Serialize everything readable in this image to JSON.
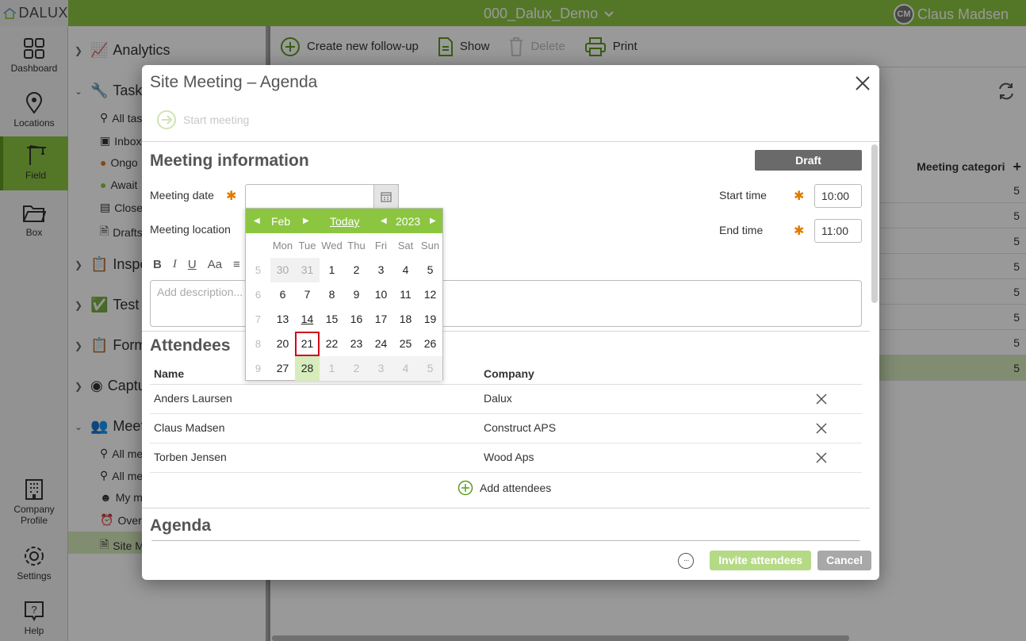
{
  "app": {
    "logo_text": "DALUX",
    "project": "000_Dalux_Demo",
    "user_initials": "CM",
    "user_name": "Claus Madsen"
  },
  "nav": {
    "dashboard": "Dashboard",
    "locations": "Locations",
    "field": "Field",
    "box": "Box",
    "company_profile_1": "Company",
    "company_profile_2": "Profile",
    "settings": "Settings",
    "help": "Help"
  },
  "tree": {
    "analytics": "Analytics",
    "tasks": "Tasks",
    "all_tasks": "All tas",
    "inbox": "Inbox",
    "ongoing": "Ongo",
    "awaiting": "Await",
    "closed": "Close",
    "drafts": "Drafts",
    "inspections": "Inspe",
    "test": "Test",
    "forms": "Form",
    "capture": "Captu",
    "meetings": "Meet",
    "all_meetings_1": "All me",
    "all_meetings_2": "All me",
    "my_meetings": "My m",
    "overdue": "Overd",
    "site_meeting": "Site M"
  },
  "toolbar": {
    "create": "Create new follow-up",
    "show": "Show",
    "delete": "Delete",
    "print": "Print"
  },
  "list": {
    "column": "Meeting categori",
    "values": [
      "5",
      "5",
      "5",
      "5",
      "5",
      "5",
      "5",
      "5"
    ]
  },
  "modal": {
    "title": "Site Meeting – Agenda",
    "start_meeting": "Start meeting",
    "meeting_info_title": "Meeting information",
    "status": "Draft",
    "meeting_date_label": "Meeting date",
    "meeting_date_value": "",
    "meeting_location_label": "Meeting location",
    "start_time_label": "Start time",
    "start_time_value": "10:00",
    "end_time_label": "End time",
    "end_time_value": "11:00",
    "rte_bold": "B",
    "rte_italic": "I",
    "rte_underline": "U",
    "rte_font": "Aa",
    "description_placeholder": "Add description...",
    "attendees_title": "Attendees",
    "col_name": "Name",
    "col_company": "Company",
    "attendees": [
      {
        "name": "Anders Laursen",
        "company": "Dalux"
      },
      {
        "name": "Claus Madsen",
        "company": "Construct APS"
      },
      {
        "name": "Torben Jensen",
        "company": "Wood Aps"
      }
    ],
    "add_attendees": "Add attendees",
    "agenda_title": "Agenda",
    "more": "···",
    "invite": "Invite attendees",
    "cancel": "Cancel"
  },
  "datepicker": {
    "month": "Feb",
    "today": "Today",
    "year": "2023",
    "weekdays": [
      "Mon",
      "Tue",
      "Wed",
      "Thu",
      "Fri",
      "Sat",
      "Sun"
    ],
    "weeks": [
      {
        "wk": "5",
        "days": [
          "30",
          "31",
          "1",
          "2",
          "3",
          "4",
          "5"
        ]
      },
      {
        "wk": "6",
        "days": [
          "6",
          "7",
          "8",
          "9",
          "10",
          "11",
          "12"
        ]
      },
      {
        "wk": "7",
        "days": [
          "13",
          "14",
          "15",
          "16",
          "17",
          "18",
          "19"
        ]
      },
      {
        "wk": "8",
        "days": [
          "20",
          "21",
          "22",
          "23",
          "24",
          "25",
          "26"
        ]
      },
      {
        "wk": "9",
        "days": [
          "27",
          "28",
          "1",
          "2",
          "3",
          "4",
          "5"
        ]
      }
    ],
    "today_day": "14",
    "selected_day": "21",
    "highlighted_day": "28",
    "accent": "#8cc641",
    "selected_border": "#d0021b"
  }
}
